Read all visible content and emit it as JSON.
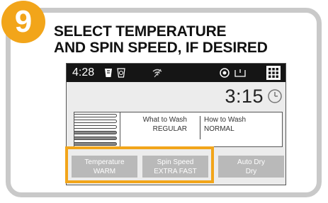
{
  "step": {
    "number": "9"
  },
  "heading": {
    "line1": "SELECT TEMPERATURE",
    "line2": "AND SPIN SPEED, IF DESIRED"
  },
  "statusbar": {
    "clock": "4:28",
    "icons": [
      "detergent-icon",
      "softener-icon",
      "wifi-icon",
      "remote-start-icon",
      "door-lock-icon",
      "menu-grid-icon"
    ]
  },
  "display": {
    "time_remaining": "3:15",
    "timer_icon": "clock-timer-icon"
  },
  "cycle": {
    "what_to_wash_label": "What to Wash",
    "what_to_wash_value": "REGULAR",
    "how_to_wash_label": "How to Wash",
    "how_to_wash_value": "NORMAL"
  },
  "options": [
    {
      "label": "Temperature",
      "value": "WARM"
    },
    {
      "label": "Spin Speed",
      "value": "EXTRA FAST"
    },
    {
      "label": "Auto Dry",
      "value": "Dry"
    }
  ],
  "colors": {
    "accent": "#f2a51a",
    "frame": "#c9c9c9",
    "button": "#b9b9b9",
    "statusbar": "#151515",
    "screen": "#ececec"
  }
}
